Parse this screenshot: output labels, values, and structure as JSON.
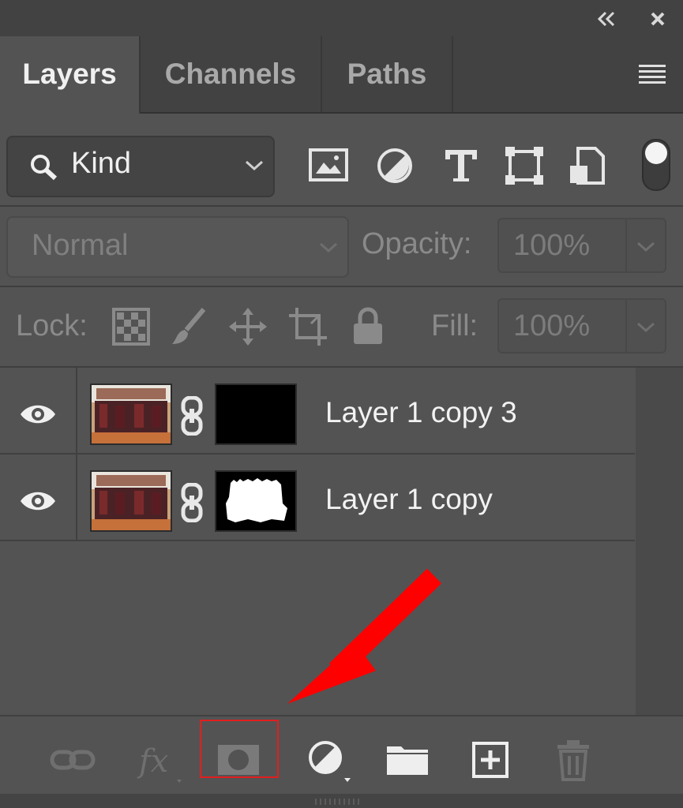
{
  "window": {
    "collapse_icon": "double-chevron-left-icon",
    "close_icon": "close-icon"
  },
  "tabs": [
    {
      "label": "Layers",
      "active": true
    },
    {
      "label": "Channels",
      "active": false
    },
    {
      "label": "Paths",
      "active": false
    }
  ],
  "filter": {
    "kind_label": "Kind",
    "icons": [
      "pixel-layer-filter-icon",
      "adjustment-layer-filter-icon",
      "type-layer-filter-icon",
      "shape-layer-filter-icon",
      "smart-object-filter-icon"
    ],
    "toggle_on": true
  },
  "blend": {
    "mode": "Normal",
    "opacity_label": "Opacity:",
    "opacity_value": "100%"
  },
  "lock": {
    "label": "Lock:",
    "icons": [
      "lock-transparent-pixels-icon",
      "lock-image-pixels-icon",
      "lock-position-icon",
      "lock-artboard-icon",
      "lock-all-icon"
    ],
    "fill_label": "Fill:",
    "fill_value": "100%"
  },
  "layers": [
    {
      "name": "Layer 1 copy 3",
      "visible": true,
      "mask": "black"
    },
    {
      "name": "Layer 1 copy",
      "visible": true,
      "mask": "white-shape"
    }
  ],
  "bottom_icons": [
    "link-layers-icon",
    "fx-icon",
    "add-layer-mask-icon",
    "adjustment-layer-icon",
    "new-group-icon",
    "new-layer-icon",
    "delete-layer-icon"
  ],
  "colors": {
    "panel_bg": "#535353",
    "highlight": "#e21e1e",
    "arrow": "#ff0000"
  }
}
